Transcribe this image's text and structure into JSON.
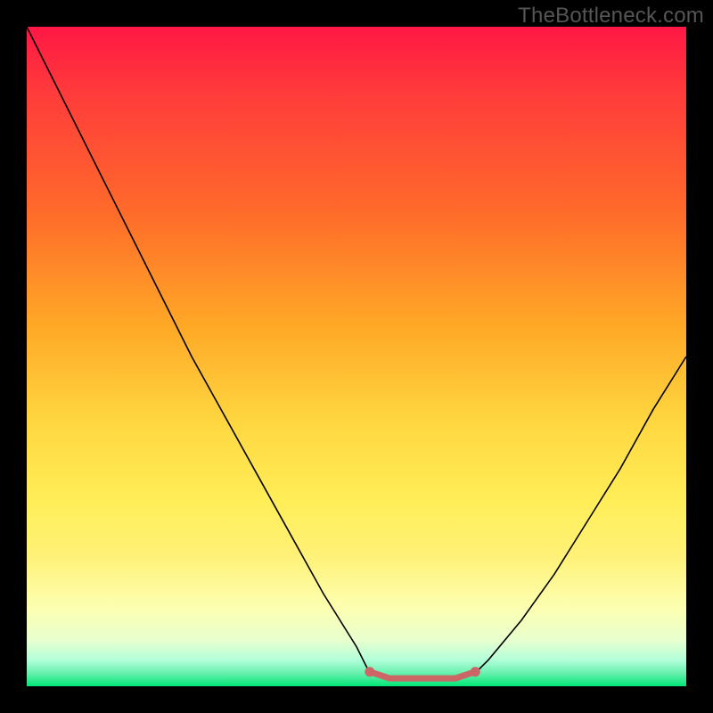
{
  "watermark": "TheBottleneck.com",
  "chart_data": {
    "type": "line",
    "title": "",
    "xlabel": "",
    "ylabel": "",
    "xlim": [
      0,
      1
    ],
    "ylim": [
      0,
      1
    ],
    "x": [
      0.0,
      0.05,
      0.1,
      0.15,
      0.2,
      0.25,
      0.3,
      0.35,
      0.4,
      0.45,
      0.5,
      0.52,
      0.55,
      0.58,
      0.62,
      0.65,
      0.68,
      0.7,
      0.75,
      0.8,
      0.85,
      0.9,
      0.95,
      1.0
    ],
    "values": [
      1.0,
      0.9,
      0.8,
      0.7,
      0.6,
      0.5,
      0.41,
      0.32,
      0.23,
      0.14,
      0.06,
      0.02,
      0.01,
      0.01,
      0.01,
      0.01,
      0.02,
      0.04,
      0.1,
      0.17,
      0.25,
      0.33,
      0.42,
      0.5
    ],
    "highlight": {
      "x": [
        0.52,
        0.55,
        0.58,
        0.62,
        0.65,
        0.68
      ],
      "values": [
        0.022,
        0.012,
        0.012,
        0.012,
        0.012,
        0.022
      ],
      "color": "#cc6666"
    },
    "gradient_stops": [
      {
        "pos": 0.0,
        "color": "#ff1744"
      },
      {
        "pos": 0.1,
        "color": "#ff3b3b"
      },
      {
        "pos": 0.28,
        "color": "#ff6a2a"
      },
      {
        "pos": 0.45,
        "color": "#ffa726"
      },
      {
        "pos": 0.6,
        "color": "#ffd740"
      },
      {
        "pos": 0.72,
        "color": "#ffee58"
      },
      {
        "pos": 0.8,
        "color": "#fff176"
      },
      {
        "pos": 0.88,
        "color": "#fdffb0"
      },
      {
        "pos": 0.93,
        "color": "#e8ffce"
      },
      {
        "pos": 0.96,
        "color": "#b2ffd9"
      },
      {
        "pos": 0.98,
        "color": "#69f0ae"
      },
      {
        "pos": 1.0,
        "color": "#00e676"
      }
    ]
  }
}
